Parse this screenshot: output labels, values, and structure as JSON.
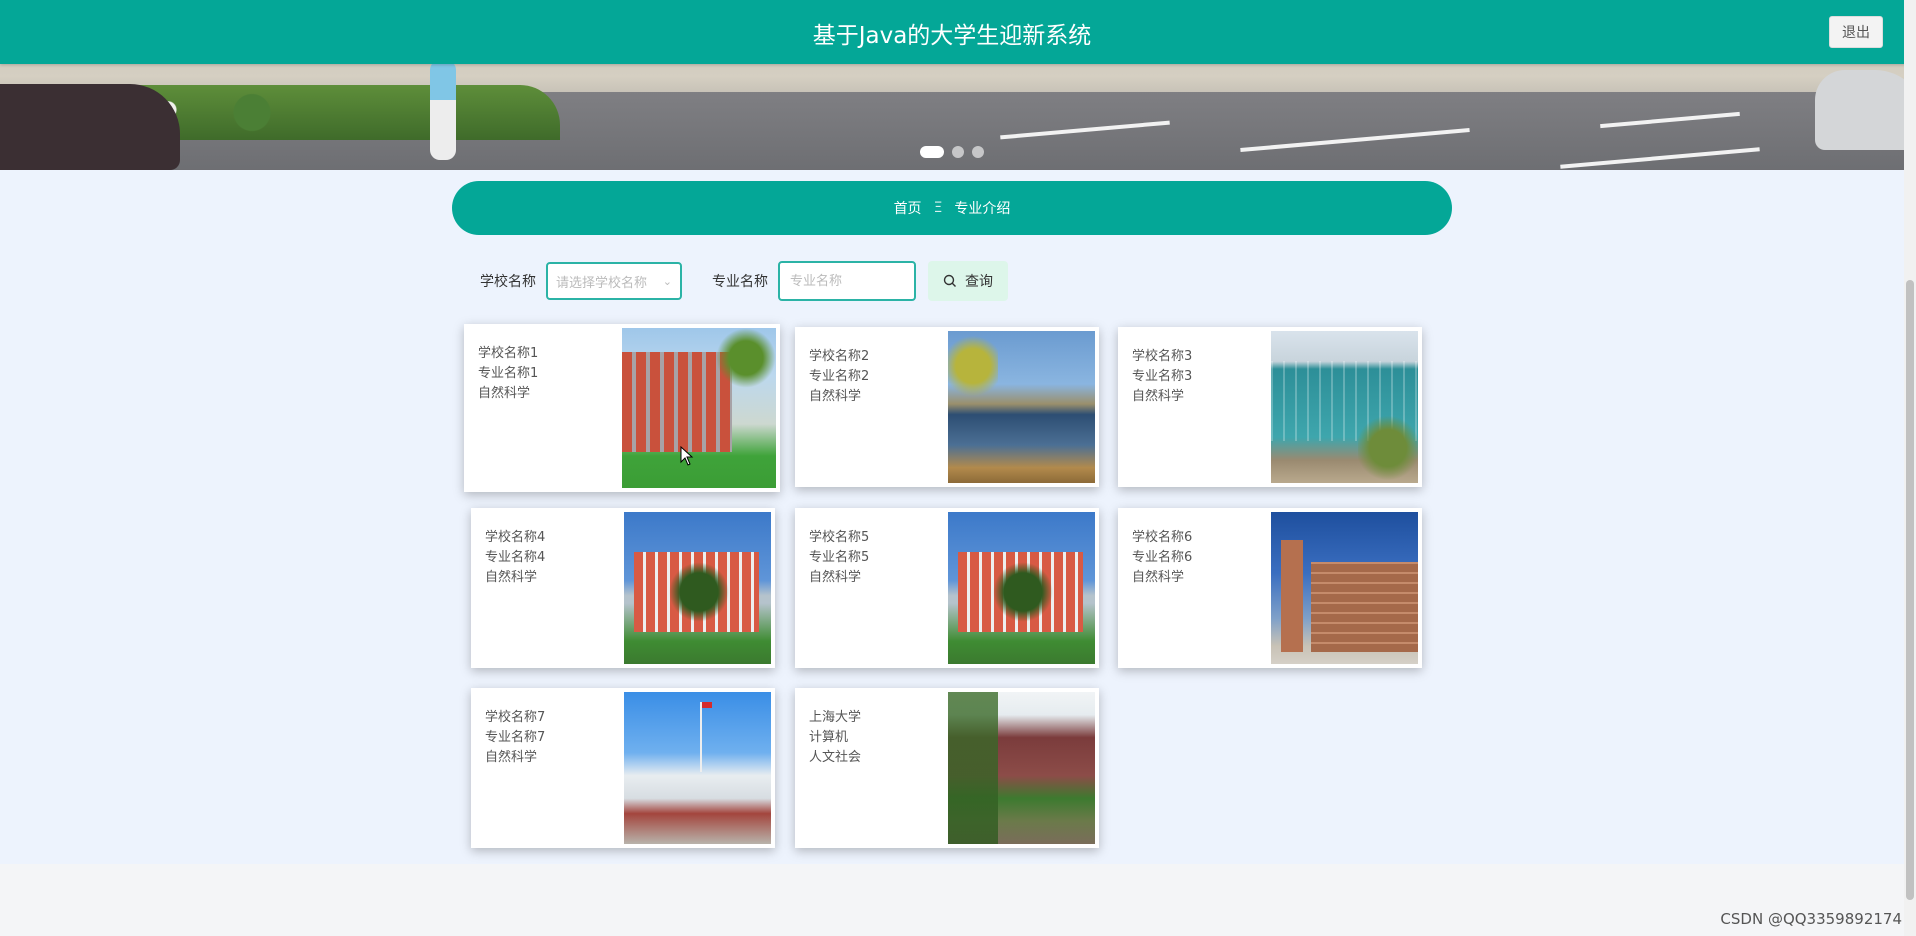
{
  "header": {
    "title": "基于Java的大学生迎新系统",
    "logout_label": "退出"
  },
  "carousel": {
    "slide_count": 3,
    "active_index": 0
  },
  "breadcrumb": {
    "home": "首页",
    "separator": "Ξ",
    "current": "专业介绍"
  },
  "search": {
    "school_label": "学校名称",
    "school_placeholder": "请选择学校名称",
    "major_label": "专业名称",
    "major_placeholder": "专业名称",
    "button_label": "查询"
  },
  "cards": [
    {
      "school": "学校名称1",
      "major": "专业名称1",
      "category": "自然科学"
    },
    {
      "school": "学校名称2",
      "major": "专业名称2",
      "category": "自然科学"
    },
    {
      "school": "学校名称3",
      "major": "专业名称3",
      "category": "自然科学"
    },
    {
      "school": "学校名称4",
      "major": "专业名称4",
      "category": "自然科学"
    },
    {
      "school": "学校名称5",
      "major": "专业名称5",
      "category": "自然科学"
    },
    {
      "school": "学校名称6",
      "major": "专业名称6",
      "category": "自然科学"
    },
    {
      "school": "学校名称7",
      "major": "专业名称7",
      "category": "自然科学"
    },
    {
      "school": "上海大学",
      "major": "计算机",
      "category": "人文社会"
    }
  ],
  "watermark": "CSDN @QQ3359892174",
  "colors": {
    "primary": "#04a797",
    "page_bg": "#edf3fd",
    "button_bg": "#ddf6ea"
  }
}
